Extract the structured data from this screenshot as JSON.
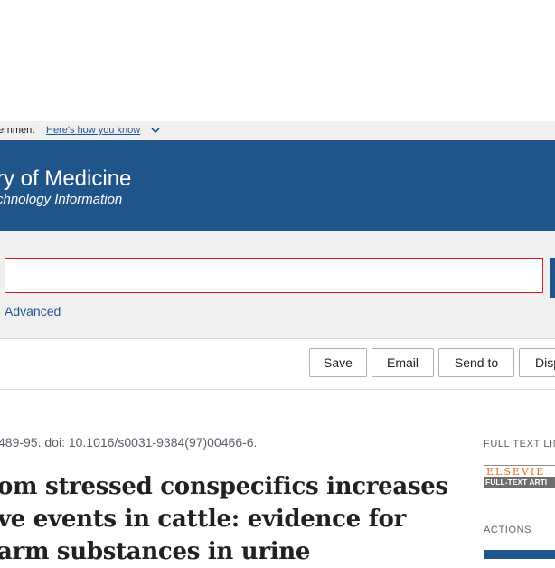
{
  "gov_banner": {
    "text": "ernment",
    "link": "Here's how you know"
  },
  "header": {
    "title": "ry of Medicine",
    "subtitle": "chnology Information"
  },
  "search": {
    "value": "",
    "advanced_label": "Advanced"
  },
  "toolbar": {
    "save_label": "Save",
    "email_label": "Email",
    "send_to_label": "Send to",
    "display_label": "Disp"
  },
  "article": {
    "citation": "489-95. doi: 10.1016/s0031-9384(97)00466-6.",
    "title_lines": [
      "om stressed conspecifics increases",
      "ve events in cattle: evidence for",
      "arm substances in urine"
    ]
  },
  "sidebar": {
    "full_text_label": "FULL TEXT LIN",
    "elsevier_top": "ELSEVIE",
    "elsevier_bottom": "FULL-TEXT ARTI",
    "actions_label": "ACTIONS"
  },
  "colors": {
    "header_bg": "#20558a",
    "banner_bg": "#f0f0f0",
    "link": "#205493",
    "search_border": "#d11b1b"
  },
  "icons": {
    "banner_chevron": "chevron-down-icon"
  }
}
